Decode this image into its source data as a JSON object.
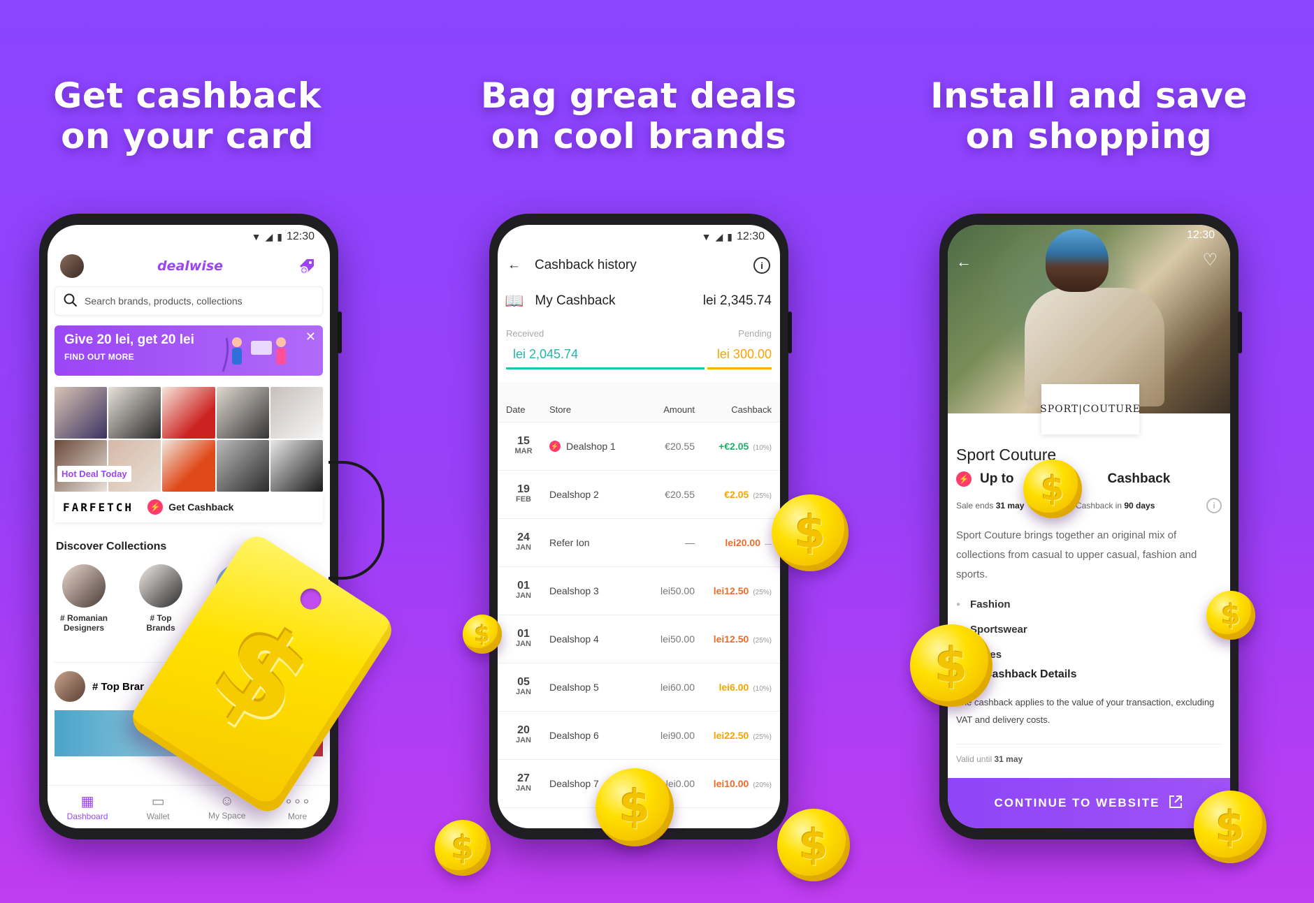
{
  "headlines": [
    {
      "line1": "Get cashback",
      "line2": "on your card"
    },
    {
      "line1": "Bag great deals",
      "line2": "on cool brands"
    },
    {
      "line1": "Install and save",
      "line2": "on shopping"
    }
  ],
  "status_time": "12:30",
  "icons": {
    "wifi": "wifi-icon",
    "signal": "signal-icon",
    "battery": "battery-icon",
    "search": "search-icon",
    "gift": "gift-tag-icon",
    "close": "close-icon",
    "back": "back-arrow-icon",
    "info": "info-icon",
    "book": "book-icon",
    "heart": "heart-icon",
    "external": "external-link-icon",
    "dashboard": "dashboard-icon",
    "wallet": "wallet-icon",
    "myspace": "profile-icon",
    "more": "more-icon"
  },
  "colors": {
    "brand": "#9a46f5",
    "received": "#1fb8a8",
    "pending": "#f7a300",
    "cashback_dot": "#ff3b6b"
  },
  "phone1": {
    "logo": "dealwise",
    "search_placeholder": "Search brands, products, collections",
    "promo": {
      "title": "Give 20 lei, get 20 lei",
      "cta": "FIND OUT MORE"
    },
    "hot_deal_label": "Hot Deal Today",
    "brand_logo": "FARFETCH",
    "get_cashback": "Get Cashback",
    "discover_title": "Discover Collections",
    "collections": [
      {
        "line1": "# Romanian",
        "line2": "Designers"
      },
      {
        "line1": "# Top",
        "line2": "Brands"
      }
    ],
    "top_brands_row": "# Top Brar",
    "tabs": [
      {
        "label": "Dashboard",
        "icon": "▦"
      },
      {
        "label": "Wallet",
        "icon": "▭"
      },
      {
        "label": "My Space",
        "icon": "☺"
      },
      {
        "label": "More",
        "icon": "∘∘∘"
      }
    ]
  },
  "phone2": {
    "title": "Cashback history",
    "my_cashback_label": "My Cashback",
    "my_cashback_total": "lei 2,345.74",
    "received_label": "Received",
    "pending_label": "Pending",
    "received_value": "lei 2,045.74",
    "pending_value": "lei 300.00",
    "columns": [
      "Date",
      "Store",
      "Amount",
      "Cashback"
    ],
    "rows": [
      {
        "day": "15",
        "month": "MAR",
        "store": "Dealshop 1",
        "amount": "€20.55",
        "cashback": "+€2.05",
        "pct": "(10%)",
        "tone": "green",
        "dot": true
      },
      {
        "day": "19",
        "month": "FEB",
        "store": "Dealshop 2",
        "amount": "€20.55",
        "cashback": "€2.05",
        "pct": "(25%)",
        "tone": "orange",
        "dot": false
      },
      {
        "day": "24",
        "month": "JAN",
        "store": "Refer Ion",
        "amount": "—",
        "cashback": "lei20.00",
        "pct": "—",
        "tone": "red",
        "dot": false
      },
      {
        "day": "01",
        "month": "JAN",
        "store": "Dealshop 3",
        "amount": "lei50.00",
        "cashback": "lei12.50",
        "pct": "(25%)",
        "tone": "red",
        "dot": false
      },
      {
        "day": "01",
        "month": "JAN",
        "store": "Dealshop 4",
        "amount": "lei50.00",
        "cashback": "lei12.50",
        "pct": "(25%)",
        "tone": "red",
        "dot": false
      },
      {
        "day": "05",
        "month": "JAN",
        "store": "Dealshop 5",
        "amount": "lei60.00",
        "cashback": "lei6.00",
        "pct": "(10%)",
        "tone": "orange",
        "dot": false
      },
      {
        "day": "20",
        "month": "JAN",
        "store": "Dealshop 6",
        "amount": "lei90.00",
        "cashback": "lei22.50",
        "pct": "(25%)",
        "tone": "orange",
        "dot": false
      },
      {
        "day": "27",
        "month": "JAN",
        "store": "Dealshop 7",
        "amount": "lei0.00",
        "cashback": "lei10.00",
        "pct": "(20%)",
        "tone": "red",
        "dot": false
      }
    ]
  },
  "phone3": {
    "brand_logo": "SPORT|COUTURE",
    "title": "Sport Couture",
    "up_to": "Up to",
    "cashback_label": "Cashback",
    "sale_ends_label": "Sale ends",
    "sale_ends_value": "31 may",
    "cashback_in_label": "Cashback in",
    "cashback_in_value": "90 days",
    "description": "Sport Couture brings together an original mix of collections from casual to upper casual, fashion and sports.",
    "categories": [
      "Fashion",
      "Sportswear",
      "Shoes"
    ],
    "details_title": "Cashback Details",
    "details_text": "The cashback applies to the value of your transaction, excluding VAT and delivery costs.",
    "valid_label": "Valid until",
    "valid_value": "31 may",
    "cta": "CONTINUE TO WEBSITE"
  }
}
